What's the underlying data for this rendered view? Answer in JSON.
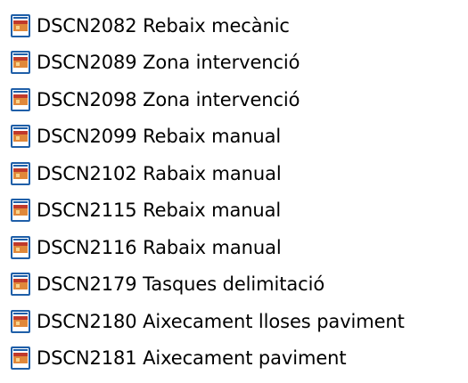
{
  "file_list": {
    "items": [
      {
        "name": "DSCN2082 Rebaix mecànic",
        "icon": "image-file-icon"
      },
      {
        "name": "DSCN2089 Zona intervenció",
        "icon": "image-file-icon"
      },
      {
        "name": "DSCN2098 Zona intervenció",
        "icon": "image-file-icon"
      },
      {
        "name": "DSCN2099 Rebaix manual",
        "icon": "image-file-icon"
      },
      {
        "name": "DSCN2102 Rabaix manual",
        "icon": "image-file-icon"
      },
      {
        "name": "DSCN2115 Rebaix manual",
        "icon": "image-file-icon"
      },
      {
        "name": "DSCN2116 Rabaix manual",
        "icon": "image-file-icon"
      },
      {
        "name": "DSCN2179 Tasques delimitació",
        "icon": "image-file-icon"
      },
      {
        "name": "DSCN2180 Aixecament lloses paviment",
        "icon": "image-file-icon"
      },
      {
        "name": "DSCN2181 Aixecament paviment",
        "icon": "image-file-icon"
      }
    ]
  },
  "colors": {
    "text": "#000000",
    "background": "#ffffff",
    "icon_frame": "#1f5fa8",
    "icon_fill": "#e0883a",
    "icon_accent": "#c0392b"
  }
}
